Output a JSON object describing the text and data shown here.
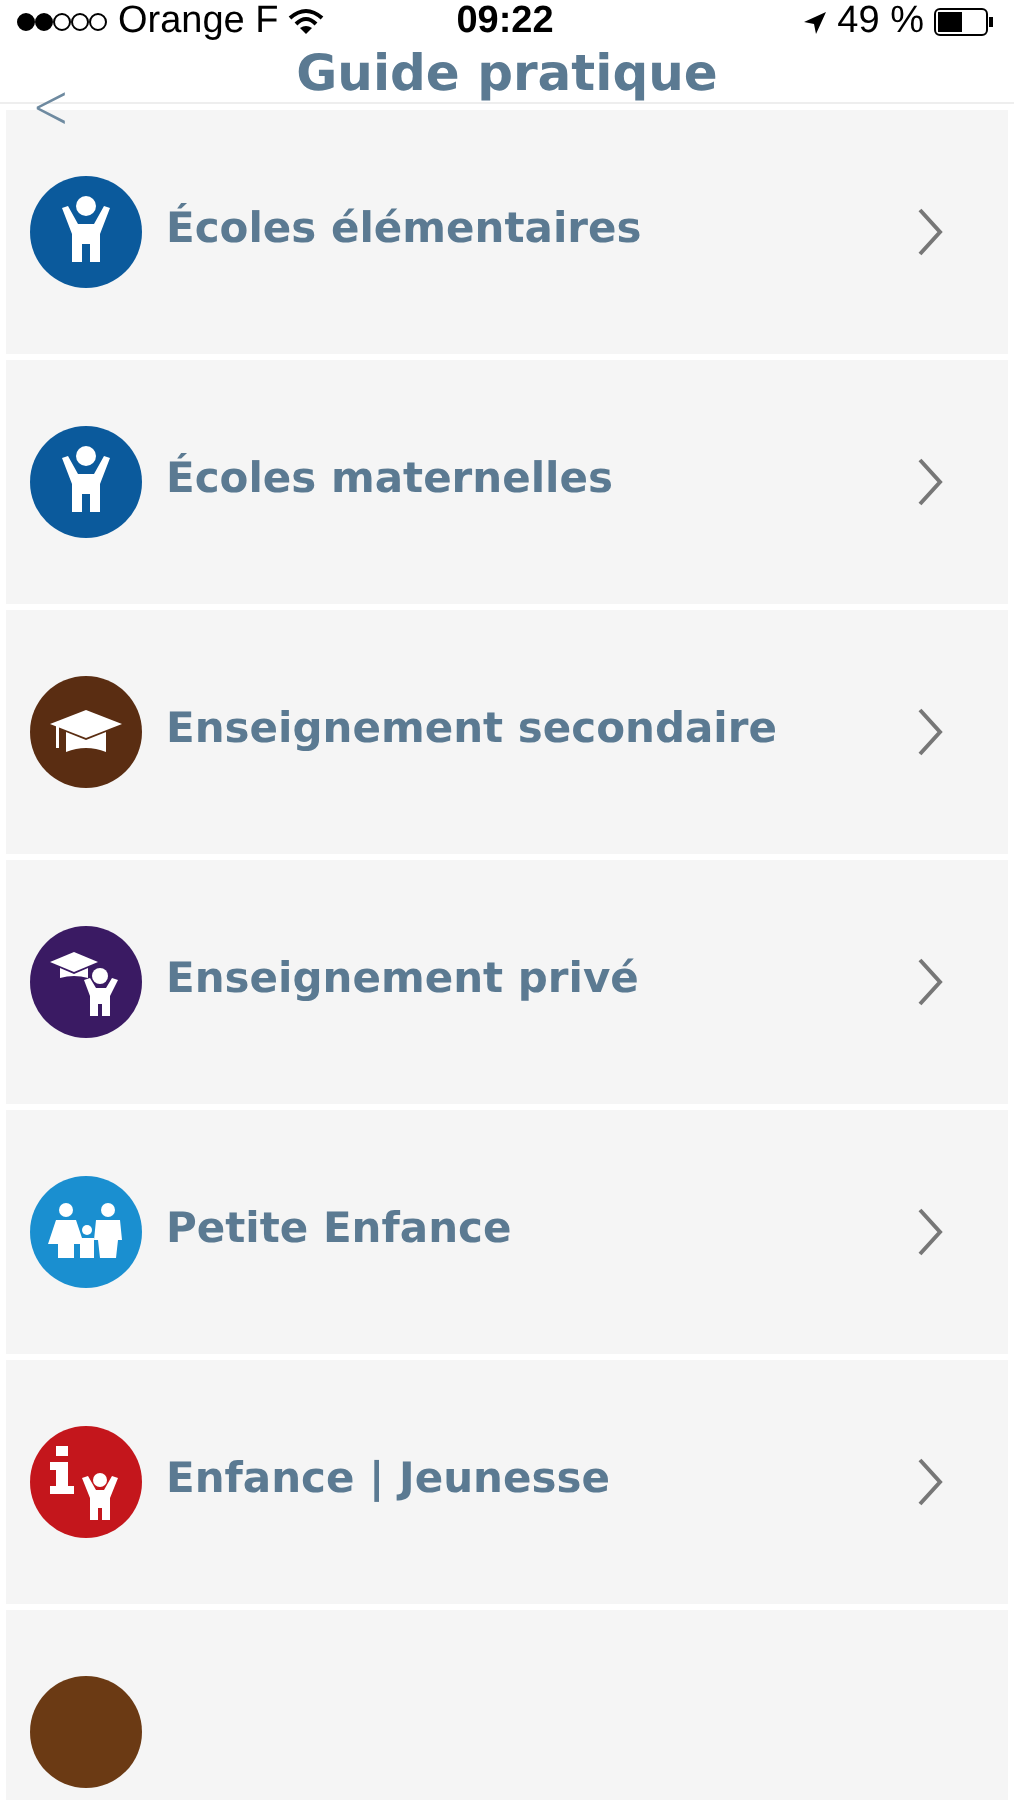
{
  "status_bar": {
    "carrier": "Orange F",
    "time": "09:22",
    "battery": "49 %"
  },
  "nav": {
    "title": "Guide pratique",
    "back": "<"
  },
  "items": [
    {
      "label": "Écoles élémentaires",
      "kind": "child",
      "color": "#0b5a9c"
    },
    {
      "label": "Écoles maternelles",
      "kind": "child",
      "color": "#0b5a9c"
    },
    {
      "label": "Enseignement secondaire",
      "kind": "cap",
      "color": "#5a2d12"
    },
    {
      "label": "Enseignement privé",
      "kind": "cap-child",
      "color": "#3a1a63"
    },
    {
      "label": "Petite Enfance",
      "kind": "family",
      "color": "#1a8fd0"
    },
    {
      "label": "Enfance | Jeunesse",
      "kind": "info-child",
      "color": "#c4161c"
    },
    {
      "kind": "partial",
      "color": "#6b3a14"
    }
  ]
}
